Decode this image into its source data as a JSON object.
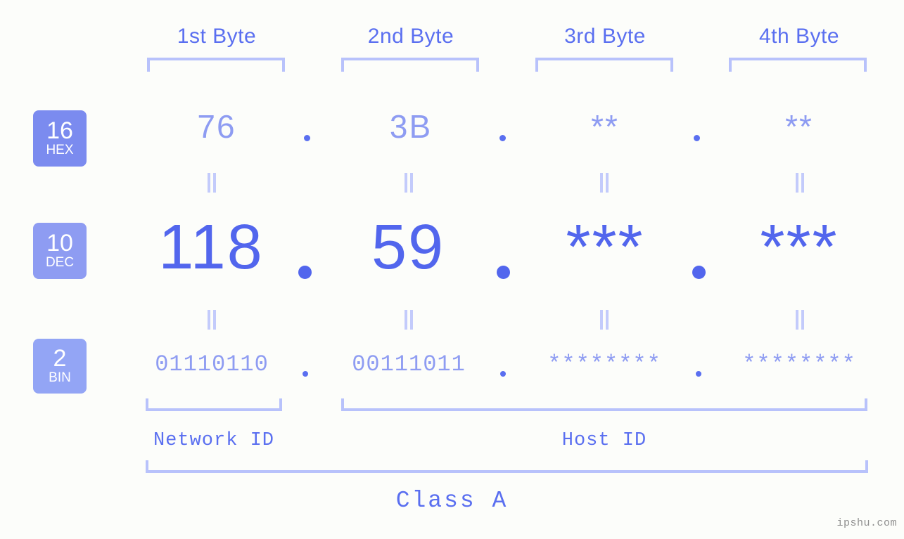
{
  "background_color": "#fcfdfa",
  "accent_colors": {
    "label_blue": "#5a6ff0",
    "bracket_blue": "#b8c2fb",
    "light_value": "#8e9cf2",
    "dec_value": "#5266ed",
    "badge_hex": "#7b8bef",
    "badge_dec": "#8e9cf2",
    "badge_bin": "#93a5f5",
    "watermark_gray": "#8f8f8f"
  },
  "byte_headers": [
    {
      "label": "1st Byte"
    },
    {
      "label": "2nd Byte"
    },
    {
      "label": "3rd Byte"
    },
    {
      "label": "4th Byte"
    }
  ],
  "bases": [
    {
      "number": "16",
      "name": "HEX"
    },
    {
      "number": "10",
      "name": "DEC"
    },
    {
      "number": "2",
      "name": "BIN"
    }
  ],
  "rows": {
    "hex": {
      "base_number": "16",
      "base_name": "HEX",
      "values": [
        "76",
        "3B",
        "**",
        "**"
      ],
      "separator": "."
    },
    "dec": {
      "base_number": "10",
      "base_name": "DEC",
      "values": [
        "118",
        "59",
        "***",
        "***"
      ],
      "separator": "."
    },
    "bin": {
      "base_number": "2",
      "base_name": "BIN",
      "values": [
        "01110110",
        "00111011",
        "********",
        "********"
      ],
      "separator": "."
    }
  },
  "equals_marks": {
    "glyph": "||",
    "count_per_gap": 4
  },
  "segments": {
    "network_id": "Network ID",
    "host_id": "Host ID"
  },
  "class": {
    "label": "Class A"
  },
  "watermark": {
    "text": "ipshu.com"
  }
}
